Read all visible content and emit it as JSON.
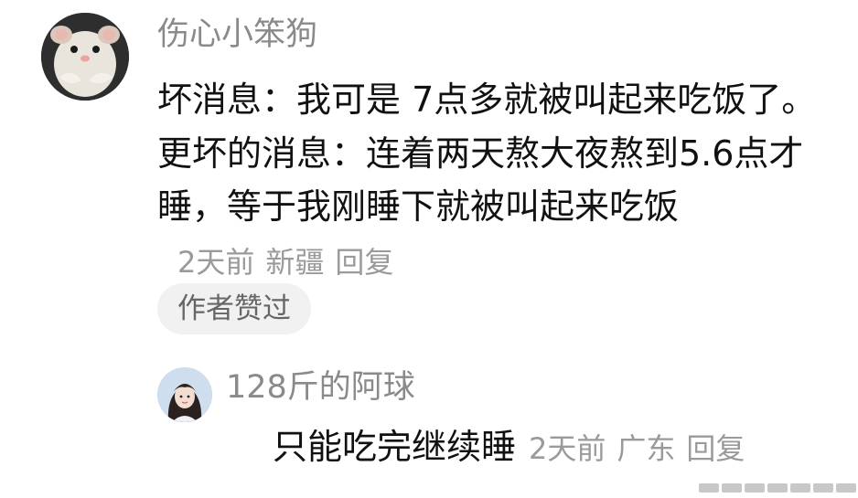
{
  "comment": {
    "username": "伤心小笨狗",
    "text": "坏消息：我可是 7点多就被叫起来吃饭了。更坏的消息：连着两天熬大夜熬到5.6点才睡，等于我刚睡下就被叫起来吃饭",
    "time": "2天前",
    "location": "新疆",
    "reply_label": "回复",
    "liked_by_author": "作者赞过",
    "avatar_icon": "hamster-avatar-icon"
  },
  "reply": {
    "username": "128斤的阿球",
    "text": "只能吃完继续睡",
    "time": "2天前",
    "location": "广东",
    "reply_label": "回复",
    "avatar_icon": "girl-avatar-icon"
  },
  "colors": {
    "username": "#8a8a8a",
    "text": "#111111",
    "meta": "#9a9a9a",
    "pill_bg": "#f1f1f1"
  }
}
